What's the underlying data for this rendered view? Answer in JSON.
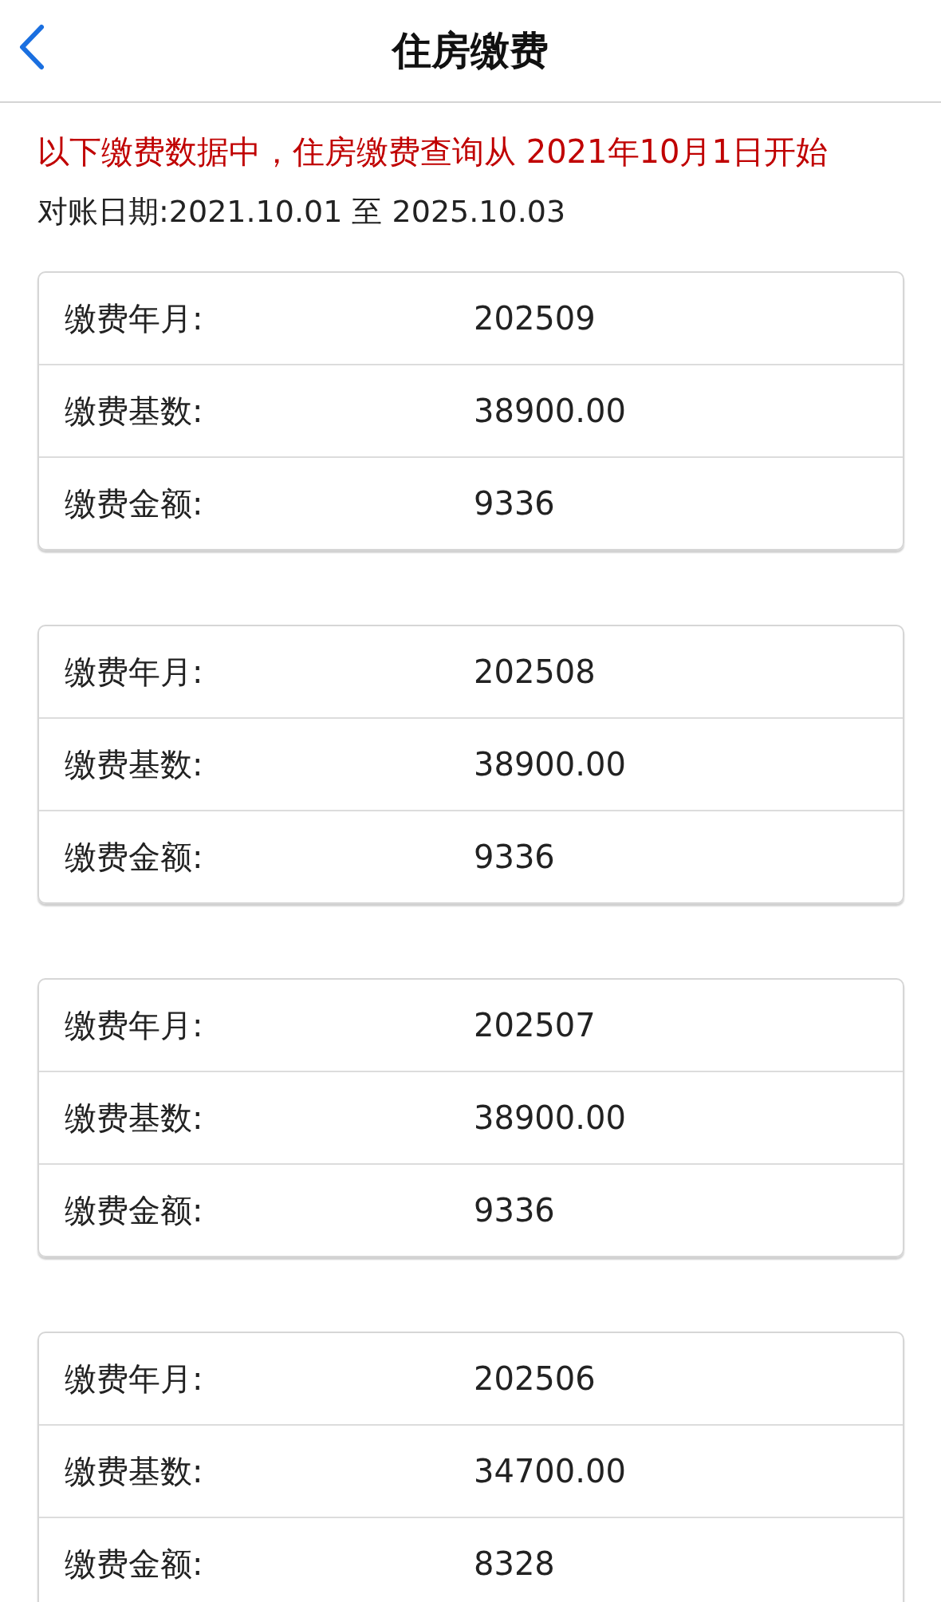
{
  "nav": {
    "title": "住房缴费"
  },
  "notice": "以下缴费数据中，住房缴费查询从 2021年10月1日开始",
  "period": "对账日期:2021.10.01 至 2025.10.03",
  "records": [
    {
      "rows": [
        {
          "label": "缴费年月:",
          "value": "202509"
        },
        {
          "label": "缴费基数:",
          "value": "38900.00"
        },
        {
          "label": "缴费金额:",
          "value": "9336"
        }
      ]
    },
    {
      "rows": [
        {
          "label": "缴费年月:",
          "value": "202508"
        },
        {
          "label": "缴费基数:",
          "value": "38900.00"
        },
        {
          "label": "缴费金额:",
          "value": "9336"
        }
      ]
    },
    {
      "rows": [
        {
          "label": "缴费年月:",
          "value": "202507"
        },
        {
          "label": "缴费基数:",
          "value": "38900.00"
        },
        {
          "label": "缴费金额:",
          "value": "9336"
        }
      ]
    },
    {
      "rows": [
        {
          "label": "缴费年月:",
          "value": "202506"
        },
        {
          "label": "缴费基数:",
          "value": "34700.00"
        },
        {
          "label": "缴费金额:",
          "value": "8328"
        }
      ]
    }
  ]
}
